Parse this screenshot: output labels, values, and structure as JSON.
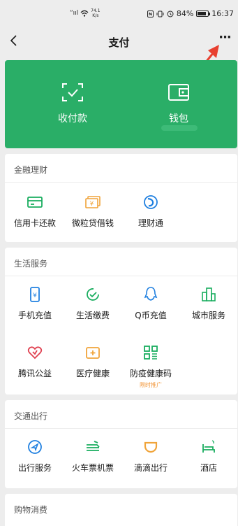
{
  "status_bar": {
    "signal_text": "”ııl",
    "net_speed_value": "74.1",
    "net_speed_unit": "K/s",
    "battery": "84%",
    "time": "16:37",
    "battery_level": 0.84
  },
  "header": {
    "title": "支付",
    "more_label": "···"
  },
  "pay_card": {
    "receive_label": "收付款",
    "wallet_label": "钱包",
    "color": "#2aae67"
  },
  "finance": {
    "title": "金融理财",
    "items": [
      {
        "label": "信用卡还款",
        "icon": "credit-card-icon"
      },
      {
        "label": "微粒贷借钱",
        "icon": "cash-loan-icon"
      },
      {
        "label": "理财通",
        "icon": "wealth-icon"
      }
    ]
  },
  "life": {
    "title": "生活服务",
    "items": [
      {
        "label": "手机充值",
        "icon": "phone-topup-icon"
      },
      {
        "label": "生活缴费",
        "icon": "utility-bill-icon"
      },
      {
        "label": "Q币充值",
        "icon": "qq-coin-icon"
      },
      {
        "label": "城市服务",
        "icon": "city-service-icon"
      },
      {
        "label": "腾讯公益",
        "icon": "charity-icon"
      },
      {
        "label": "医疗健康",
        "icon": "medical-icon"
      },
      {
        "label": "防疫健康码",
        "icon": "health-code-icon",
        "tag": "限时推广"
      }
    ]
  },
  "travel": {
    "title": "交通出行",
    "items": [
      {
        "label": "出行服务",
        "icon": "travel-service-icon"
      },
      {
        "label": "火车票机票",
        "icon": "train-ticket-icon"
      },
      {
        "label": "滴滴出行",
        "icon": "didi-icon"
      },
      {
        "label": "酒店",
        "icon": "hotel-icon"
      }
    ]
  },
  "shopping": {
    "title": "购物消费"
  }
}
